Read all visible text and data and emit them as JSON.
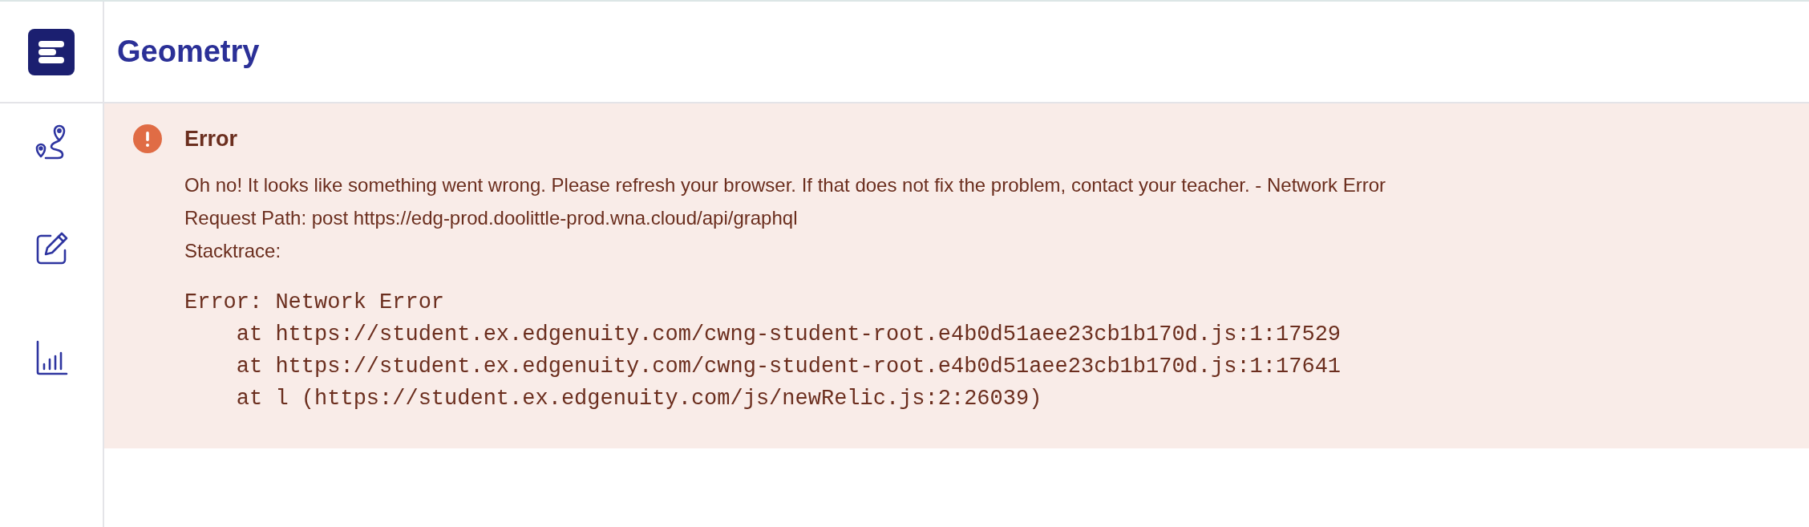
{
  "header": {
    "title": "Geometry"
  },
  "alert": {
    "title": "Error",
    "message_lines": [
      "Oh no! It looks like something went wrong. Please refresh your browser. If that does not fix the problem, contact your teacher. - Network Error",
      "Request Path: post https://edg-prod.doolittle-prod.wna.cloud/api/graphql",
      "Stacktrace:"
    ],
    "stack_trace": [
      "Error: Network Error",
      "    at https://student.ex.edgenuity.com/cwng-student-root.e4b0d51aee23cb1b170d.js:1:17529",
      "    at https://student.ex.edgenuity.com/cwng-student-root.e4b0d51aee23cb1b170d.js:1:17641",
      "    at l (https://student.ex.edgenuity.com/js/newRelic.js:2:26039)"
    ]
  }
}
